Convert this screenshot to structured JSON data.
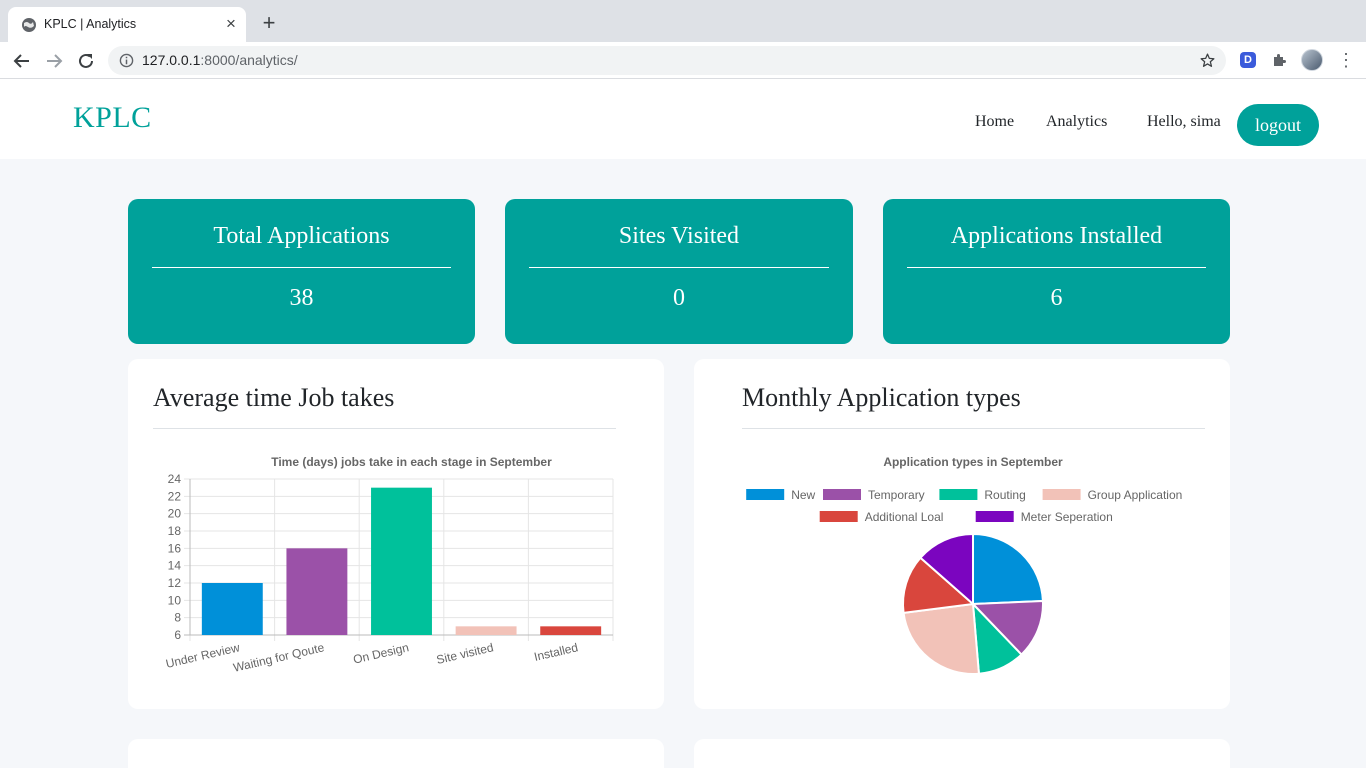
{
  "browser": {
    "tab_title": "KPLC | Analytics",
    "tab_close_glyph": "×",
    "new_tab_glyph": "+",
    "url_host": "127.0.0.1",
    "url_rest": ":8000/analytics/",
    "extension_label": "D",
    "menu_glyph": "⋮"
  },
  "header": {
    "brand": "KPLC",
    "nav": {
      "home": "Home",
      "analytics": "Analytics"
    },
    "greeting": "Hello, sima",
    "logout_label": "logout",
    "accent_color": "#00a19a"
  },
  "stats": [
    {
      "title": "Total Applications",
      "value": "38"
    },
    {
      "title": "Sites Visited",
      "value": "0"
    },
    {
      "title": "Applications Installed",
      "value": "6"
    }
  ],
  "panels": {
    "avg_time": {
      "heading": "Average time Job takes"
    },
    "monthly_types": {
      "heading": "Monthly Application types"
    }
  },
  "chart_data": [
    {
      "type": "bar",
      "title": "Time (days) jobs take in each stage in September",
      "categories": [
        "Under Review",
        "Waiting for Qoute",
        "On Design",
        "Site visited",
        "Installed"
      ],
      "values": [
        12,
        16,
        23,
        7,
        7
      ],
      "colors": [
        "#0090d9",
        "#9b51a8",
        "#00c19b",
        "#f2c2b8",
        "#d9463d"
      ],
      "ylim": [
        6,
        24
      ],
      "yticks": [
        6,
        8,
        10,
        12,
        14,
        16,
        18,
        20,
        22,
        24
      ],
      "grid": true,
      "xlabel": "",
      "ylabel": ""
    },
    {
      "type": "pie",
      "title": "Application types in September",
      "legend_position": "top",
      "slices": [
        {
          "label": "New",
          "value": 9,
          "color": "#0090d9"
        },
        {
          "label": "Temporary",
          "value": 5,
          "color": "#9b51a8"
        },
        {
          "label": "Routing",
          "value": 4,
          "color": "#00c19b"
        },
        {
          "label": "Group Application",
          "value": 9,
          "color": "#f2c2b8"
        },
        {
          "label": "Additional Loal",
          "value": 5,
          "color": "#d9463d"
        },
        {
          "label": "Meter Seperation",
          "value": 5,
          "color": "#7b05bf"
        }
      ]
    }
  ]
}
